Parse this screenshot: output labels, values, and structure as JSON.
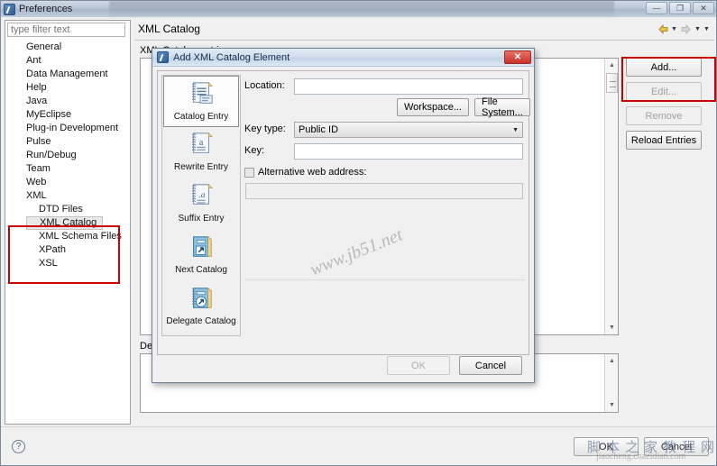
{
  "window": {
    "title": "Preferences",
    "icon": "eclipse-icon",
    "buttons": [
      {
        "name": "minimize",
        "glyph": "—"
      },
      {
        "name": "maximize",
        "glyph": "❐"
      },
      {
        "name": "close",
        "glyph": "✕"
      }
    ]
  },
  "sidebar": {
    "filter_placeholder": "type filter text",
    "filter_value": "",
    "items": [
      {
        "label": "General",
        "level": 0,
        "selected": false
      },
      {
        "label": "Ant",
        "level": 0,
        "selected": false
      },
      {
        "label": "Data Management",
        "level": 0,
        "selected": false
      },
      {
        "label": "Help",
        "level": 0,
        "selected": false
      },
      {
        "label": "Java",
        "level": 0,
        "selected": false
      },
      {
        "label": "MyEclipse",
        "level": 0,
        "selected": false
      },
      {
        "label": "Plug-in Development",
        "level": 0,
        "selected": false
      },
      {
        "label": "Pulse",
        "level": 0,
        "selected": false
      },
      {
        "label": "Run/Debug",
        "level": 0,
        "selected": false
      },
      {
        "label": "Team",
        "level": 0,
        "selected": false
      },
      {
        "label": "Web",
        "level": 0,
        "selected": false
      },
      {
        "label": "XML",
        "level": 0,
        "selected": false
      },
      {
        "label": "DTD Files",
        "level": 1,
        "selected": false
      },
      {
        "label": "XML Catalog",
        "level": 1,
        "selected": true
      },
      {
        "label": "XML Schema Files",
        "level": 1,
        "selected": false
      },
      {
        "label": "XPath",
        "level": 1,
        "selected": false
      },
      {
        "label": "XSL",
        "level": 1,
        "selected": false
      }
    ]
  },
  "content": {
    "page_title": "XML Catalog",
    "entries_label": "XML Catalog entries",
    "details_label": "Details",
    "nav": [
      {
        "name": "back-arrow-icon",
        "glyph": "◄"
      },
      {
        "name": "back-dropdown-icon",
        "glyph": "▼"
      },
      {
        "name": "forward-arrow-icon",
        "glyph": "⇨"
      },
      {
        "name": "forward-dropdown-icon",
        "glyph": "▼"
      },
      {
        "name": "view-menu-icon",
        "glyph": "▼"
      }
    ],
    "side_buttons": [
      {
        "label": "Add...",
        "disabled": false,
        "highlighted": true
      },
      {
        "label": "Edit...",
        "disabled": true,
        "highlighted": false
      },
      {
        "label": "Remove",
        "disabled": true,
        "highlighted": false
      },
      {
        "label": "Reload Entries",
        "disabled": false,
        "highlighted": false
      }
    ],
    "scroll_glyphs": {
      "up": "▲",
      "down": "▼"
    }
  },
  "bottom_bar": {
    "help_icon": "question-mark-icon",
    "help_glyph": "?",
    "buttons": [
      {
        "label": "OK"
      },
      {
        "label": "Cancel"
      }
    ]
  },
  "dialog": {
    "title": "Add XML Catalog Element",
    "icon": "eclipse-icon",
    "close_glyph": "✕",
    "type_list": [
      {
        "label": "Catalog Entry",
        "icon": "catalog-entry-icon",
        "selected": true
      },
      {
        "label": "Rewrite Entry",
        "icon": "rewrite-entry-icon",
        "selected": false
      },
      {
        "label": "Suffix Entry",
        "icon": "suffix-entry-icon",
        "selected": false
      },
      {
        "label": "Next Catalog",
        "icon": "next-catalog-icon",
        "selected": false
      },
      {
        "label": "Delegate Catalog",
        "icon": "delegate-catalog-icon",
        "selected": false
      }
    ],
    "form": {
      "location_label": "Location:",
      "location_value": "",
      "workspace_button": "Workspace...",
      "filesystem_button": "File System...",
      "keytype_label": "Key type:",
      "keytype_value": "Public ID",
      "keytype_caret": "▼",
      "key_label": "Key:",
      "key_value": "",
      "alt_web_label": "Alternative web address:",
      "alt_web_checked": false,
      "alt_web_value": ""
    },
    "footer_buttons": [
      {
        "label": "OK",
        "disabled": true
      },
      {
        "label": "Cancel",
        "disabled": false
      }
    ]
  },
  "watermarks": {
    "dialog": "www.jb51.net",
    "bottom_cn": "脚本之家教程网",
    "bottom_url": "jiaocheng.chazidian.com"
  }
}
